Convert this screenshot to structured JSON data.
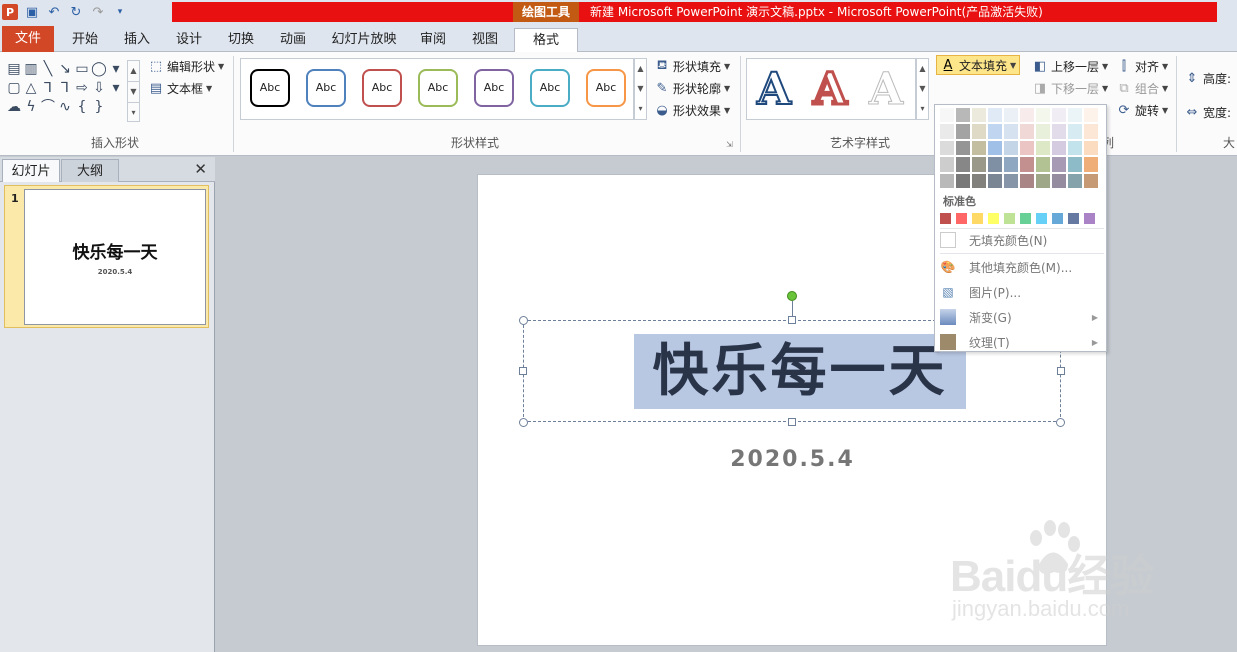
{
  "titlebar": {
    "tools_label": "绘图工具",
    "title": "新建 Microsoft PowerPoint 演示文稿.pptx - Microsoft PowerPoint(产品激活失败)"
  },
  "tabs": [
    "文件",
    "开始",
    "插入",
    "设计",
    "切换",
    "动画",
    "幻灯片放映",
    "审阅",
    "视图",
    "格式"
  ],
  "ribbon": {
    "insert_shapes": {
      "edit_shape": "编辑形状",
      "text_box": "文本框",
      "label": "插入形状"
    },
    "shape_styles": {
      "box_label": "Abc",
      "fill": "形状填充",
      "outline": "形状轮廓",
      "effects": "形状效果",
      "label": "形状样式"
    },
    "wordart": {
      "letter": "A",
      "text_fill": "文本填充",
      "label": "艺术字样式"
    },
    "arrange": {
      "bring_forward": "上移一层",
      "send_backward": "下移一层",
      "align": "对齐",
      "group": "组合",
      "rotate": "旋转",
      "label": "排列"
    },
    "size": {
      "height": "高度:",
      "width": "宽度:",
      "label": "大"
    }
  },
  "panel": {
    "tab_slides": "幻灯片",
    "tab_outline": "大纲",
    "slide_number": "1",
    "thumb_title": "快乐每一天",
    "thumb_date": "2020.5.4"
  },
  "slide": {
    "title": "快乐每一天",
    "date": "2020.5.4"
  },
  "text_fill_menu": {
    "standard_label": "标准色",
    "no_fill": "无填充颜色(N)",
    "more_colors": "其他填充颜色(M)...",
    "picture": "图片(P)...",
    "gradient": "渐变(G)",
    "texture": "纹理(T)"
  },
  "colors": {
    "accent_red": "#e81010",
    "file_tab": "#d24726",
    "highlight": "#b8c7e2",
    "title_text": "#2a3449"
  },
  "watermark": {
    "brand": "Baidu经验",
    "url": "jingyan.baidu.com"
  }
}
